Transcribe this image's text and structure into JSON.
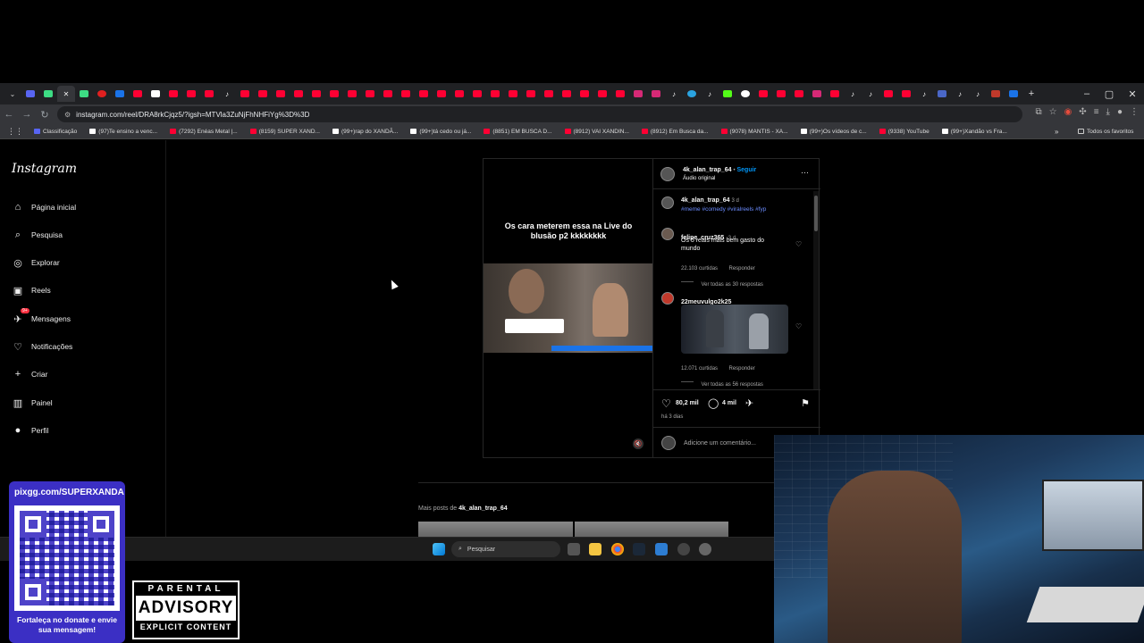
{
  "browser": {
    "url": "instagram.com/reel/DRA8rkCjqz5/?igsh=MTVla3ZuNjFhNHFiYg%3D%3D",
    "bookmarks": [
      "Classificação",
      "(97)Te ensino a venc...",
      "(7292) Enéas Metal |...",
      "(8159) SUPER XAND...",
      "(99+)rap do XANDÃ...",
      "(99+)tá cedo ou já...",
      "(8851) EM BUSCA D...",
      "(8912) VAI XANDIN...",
      "(8912) Em Busca da...",
      "(9078) MANTIS - XA...",
      "(99+)Os vídeos de c...",
      "(9338) YouTube",
      "(99+)Xandão vs Fra..."
    ],
    "all_favorites": "Todos os favoritos"
  },
  "instagram": {
    "logo": "Instagram",
    "nav": [
      {
        "label": "Página inicial",
        "icon": "home-icon"
      },
      {
        "label": "Pesquisa",
        "icon": "search-icon"
      },
      {
        "label": "Explorar",
        "icon": "compass-icon"
      },
      {
        "label": "Reels",
        "icon": "reels-icon"
      },
      {
        "label": "Mensagens",
        "icon": "messenger-icon",
        "badge": "9+"
      },
      {
        "label": "Notificações",
        "icon": "heart-icon"
      },
      {
        "label": "Criar",
        "icon": "plus-icon"
      },
      {
        "label": "Painel",
        "icon": "dashboard-icon"
      },
      {
        "label": "Perfil",
        "icon": "profile-icon"
      }
    ],
    "post": {
      "video_caption": "Os cara meterem essa na Live do blusão  p2 kkkkkkkk",
      "author": "4k_alan_trap_64",
      "follow": "Seguir",
      "audio": "Áudio original",
      "caption_user": "4k_alan_trap_64",
      "caption_time": "3 d",
      "hashtags": "#meme #comedy #viralreels #fyp",
      "comments": [
        {
          "user": "felipe_cruz365",
          "time": "3 d",
          "text": "Os 5 reais mais bem gasto do mundo",
          "likes": "22.103 curtidas",
          "reply": "Responder",
          "view_replies": "Ver todas as 30 respostas"
        },
        {
          "user": "22meuvulgo2k25",
          "time": "",
          "text": "",
          "likes": "12.071 curtidas",
          "reply": "Responder",
          "view_replies": "Ver todas as 56 respostas"
        }
      ],
      "like_count": "80,2 mil",
      "comment_count": "4 mil",
      "posted": "há 3 dias",
      "add_comment": "Adicione um comentário..."
    },
    "more_posts_prefix": "Mais posts de",
    "more_posts_user": "4k_alan_trap_64"
  },
  "taskbar": {
    "search_placeholder": "Pesquisar"
  },
  "overlay": {
    "pix_title": "pixgg.com/SUPERXANDA",
    "pix_footer": "Fortaleça no donate e envie sua mensagem!",
    "advisory_top": "PARENTAL",
    "advisory_mid": "ADVISORY",
    "advisory_bottom": "EXPLICIT CONTENT"
  },
  "colors": {
    "accent_blue": "#0095f6",
    "pix_purple": "#3b2fc4",
    "notification_red": "#ff3040"
  }
}
